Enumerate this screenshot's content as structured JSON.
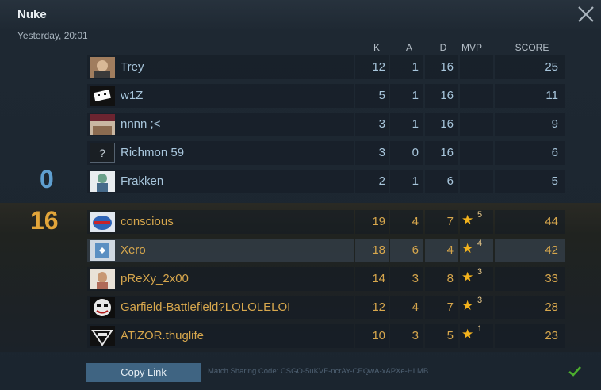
{
  "header": {
    "map": "Nuke",
    "date": "Yesterday, 20:01"
  },
  "columns": {
    "k": "K",
    "a": "A",
    "d": "D",
    "mvp": "MVP",
    "score": "SCORE"
  },
  "ct": {
    "score": "0",
    "players": [
      {
        "name": "Trey",
        "k": "12",
        "a": "1",
        "d": "16",
        "mvp": "",
        "score": "25"
      },
      {
        "name": "w1Z",
        "k": "5",
        "a": "1",
        "d": "16",
        "mvp": "",
        "score": "11"
      },
      {
        "name": "nnnn ;<",
        "k": "3",
        "a": "1",
        "d": "16",
        "mvp": "",
        "score": "9"
      },
      {
        "name": "Richmon 59",
        "k": "3",
        "a": "0",
        "d": "16",
        "mvp": "",
        "score": "6",
        "avatar_text": "?"
      },
      {
        "name": "Frakken",
        "k": "2",
        "a": "1",
        "d": "6",
        "mvp": "",
        "score": "5"
      }
    ]
  },
  "t": {
    "score": "16",
    "players": [
      {
        "name": "conscious",
        "k": "19",
        "a": "4",
        "d": "7",
        "mvp": "5",
        "score": "44"
      },
      {
        "name": "Xero",
        "k": "18",
        "a": "6",
        "d": "4",
        "mvp": "4",
        "score": "42"
      },
      {
        "name": "pReXy_2x00",
        "k": "14",
        "a": "3",
        "d": "8",
        "mvp": "3",
        "score": "33"
      },
      {
        "name": "Garfield-Battlefield?LOLOLELOI",
        "k": "12",
        "a": "4",
        "d": "7",
        "mvp": "3",
        "score": "28"
      },
      {
        "name": "ATiZOR.thuglife",
        "k": "10",
        "a": "3",
        "d": "5",
        "mvp": "1",
        "score": "23"
      }
    ]
  },
  "footer": {
    "copy_label": "Copy Link",
    "share_code": "Match Sharing Code: CSGO-5uKVF-ncrAY-CEQwA-xAPXe-HLMB"
  },
  "colors": {
    "ct": "#a8c6dc",
    "t": "#d7a74d",
    "star": "#f2b21d",
    "check": "#4caf2d"
  }
}
